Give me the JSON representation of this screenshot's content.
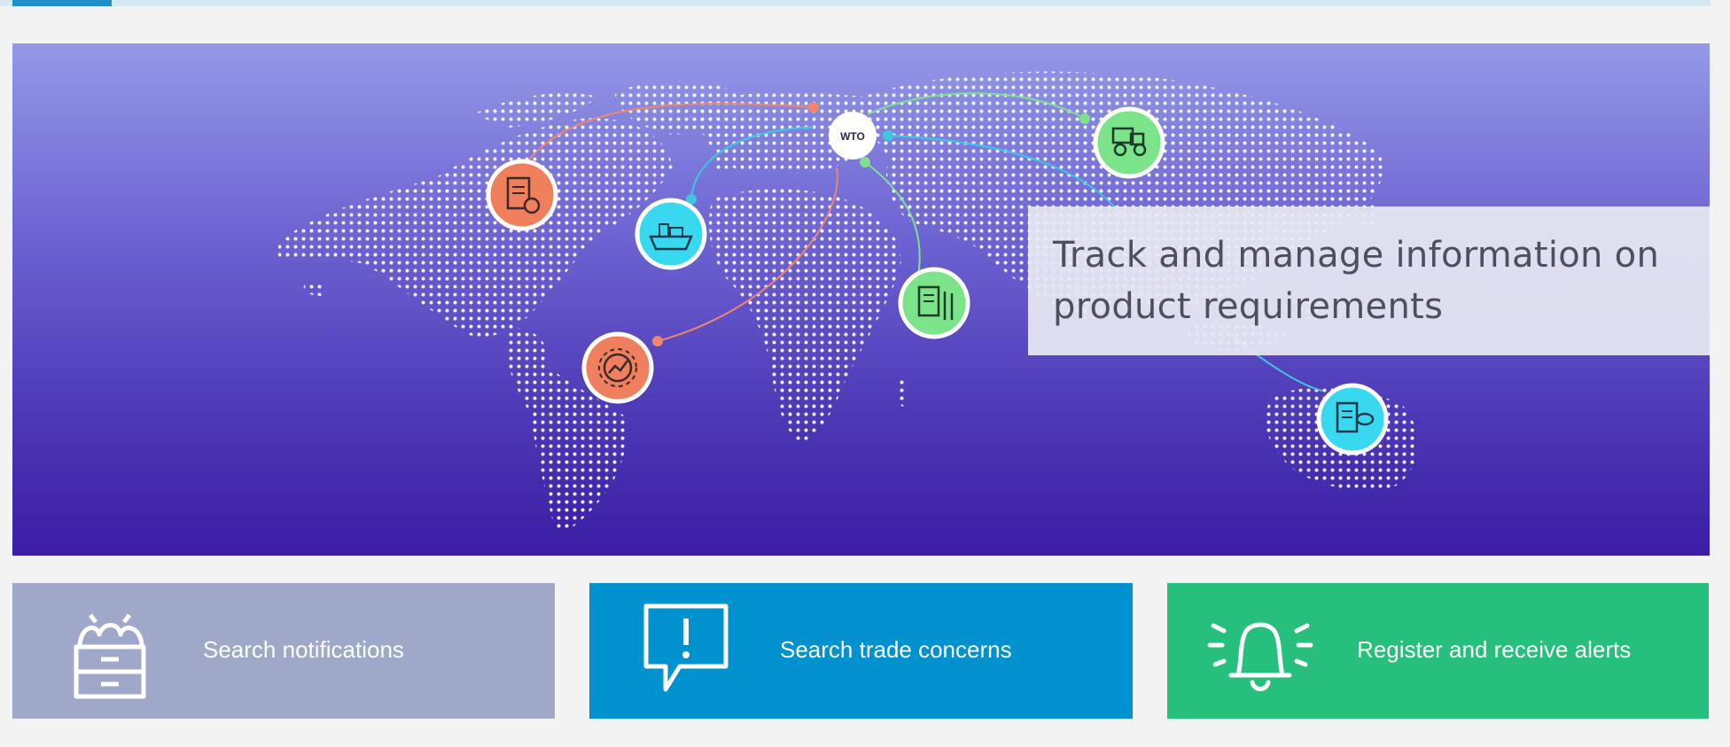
{
  "hero": {
    "caption": "Track and manage information on\nproduct requirements",
    "hub_label": "WTO",
    "icons": [
      {
        "name": "document-gear-icon",
        "color": "#f07f5e"
      },
      {
        "name": "cargo-ship-icon",
        "color": "#38d9f0"
      },
      {
        "name": "gear-chart-icon",
        "color": "#f07f5e"
      },
      {
        "name": "document-wheat-icon",
        "color": "#7be38a"
      },
      {
        "name": "tractor-icon",
        "color": "#7be38a"
      },
      {
        "name": "document-fish-icon",
        "color": "#38d9f0"
      }
    ]
  },
  "cards": [
    {
      "label": "Search notifications",
      "icon": "crate-icon",
      "color": "#9fa8c9"
    },
    {
      "label": "Search trade concerns",
      "icon": "alert-speech-icon",
      "color": "#0091cf"
    },
    {
      "label": "Register and receive alerts",
      "icon": "bell-icon",
      "color": "#26c07c"
    }
  ],
  "colors": {
    "accent": "#1f8fc7",
    "hero_top": "#9499e6",
    "hero_bottom": "#3a1da4"
  }
}
